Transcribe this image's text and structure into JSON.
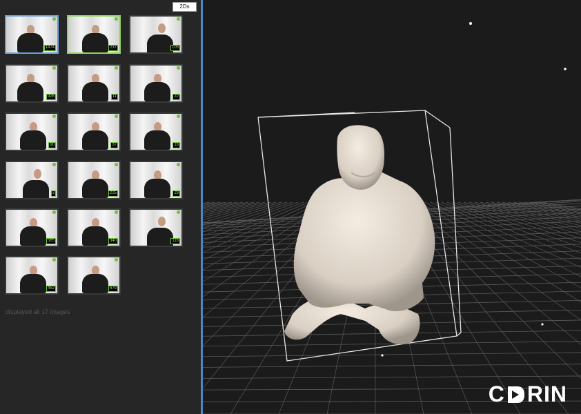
{
  "gallery": {
    "view_tag": "2Ds",
    "status": "displayed all 17 images",
    "thumbnails": [
      {
        "count": "1474",
        "pose": "lean-left",
        "selected": "blue"
      },
      {
        "count": "237",
        "pose": "center",
        "selected": "green"
      },
      {
        "count": "105",
        "pose": "reclined",
        "selected": "none"
      },
      {
        "count": "928",
        "pose": "lean-left",
        "selected": "none"
      },
      {
        "count": "11",
        "pose": "center",
        "selected": "none"
      },
      {
        "count": "22",
        "pose": "center",
        "selected": "none"
      },
      {
        "count": "90",
        "pose": "center",
        "selected": "none"
      },
      {
        "count": "37",
        "pose": "center",
        "selected": "none"
      },
      {
        "count": "16",
        "pose": "center",
        "selected": "none"
      },
      {
        "count": "3",
        "pose": "reclined",
        "selected": "none"
      },
      {
        "count": "225",
        "pose": "center",
        "selected": "none"
      },
      {
        "count": "29",
        "pose": "center",
        "selected": "none"
      },
      {
        "count": "565",
        "pose": "center",
        "selected": "none"
      },
      {
        "count": "340",
        "pose": "center",
        "selected": "none"
      },
      {
        "count": "116",
        "pose": "reclined",
        "selected": "none"
      },
      {
        "count": "452",
        "pose": "center",
        "selected": "none"
      },
      {
        "count": "679",
        "pose": "center",
        "selected": "none"
      }
    ]
  },
  "viewport": {
    "logo_text": "CDRIN",
    "colors": {
      "background": "#1b1b1b",
      "grid": "#5a5a5a",
      "bounding_box": "#e6e6e6",
      "model": "#e8ddd1",
      "selection_blue": "#6a9fd8",
      "selection_green": "#8fd45a",
      "badge_green": "#6fc13a"
    }
  }
}
